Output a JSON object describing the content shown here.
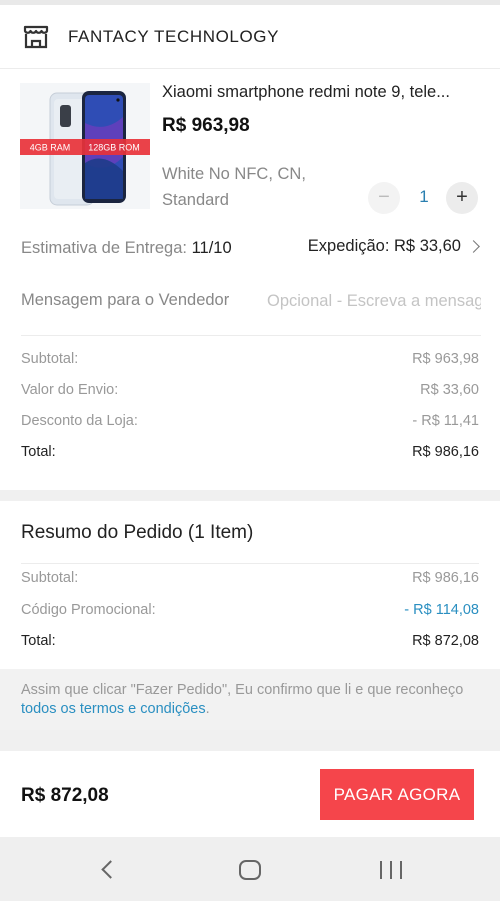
{
  "store": {
    "name": "FANTACY  TECHNOLOGY",
    "icon": "store-icon"
  },
  "product": {
    "title": "Xiaomi smartphone redmi note 9, tele...",
    "price": "R$ 963,98",
    "variant": "White No NFC, CN, Standard",
    "badge_ram": "4GB RAM",
    "badge_rom": "128GB ROM",
    "quantity": "1",
    "qty_minus": "−",
    "qty_plus": "+"
  },
  "delivery": {
    "label": "Estimativa de Entrega:",
    "date": "11/10",
    "shipping_label": "Expedição: R$ 33,60"
  },
  "message": {
    "label": "Mensagem para o Vendedor",
    "placeholder": "Opcional - Escreva a mensagem"
  },
  "store_summary": [
    {
      "label": "Subtotal:",
      "value": "R$ 963,98"
    },
    {
      "label": "Valor do Envio:",
      "value": "R$ 33,60"
    },
    {
      "label": "Desconto da Loja:",
      "value": "- R$ 11,41"
    },
    {
      "label": "Total:",
      "value": "R$ 986,16"
    }
  ],
  "order_summary": {
    "title": "Resumo do Pedido (1 Item)",
    "rows": [
      {
        "label": "Subtotal:",
        "value": "R$ 986,16"
      },
      {
        "label": "Código Promocional:",
        "value": "- R$ 114,08"
      },
      {
        "label": "Total:",
        "value": "R$ 872,08"
      }
    ]
  },
  "terms": {
    "text": "Assim que clicar \"Fazer Pedido\", Eu confirmo que li e que reconheço ",
    "link": "todos os termos e condições",
    "end": "."
  },
  "checkout": {
    "total": "R$ 872,08",
    "button": "PAGAR AGORA"
  },
  "colors": {
    "accent": "#f5454b",
    "link": "#2a8fc1",
    "quantity": "#2a7fb0"
  }
}
